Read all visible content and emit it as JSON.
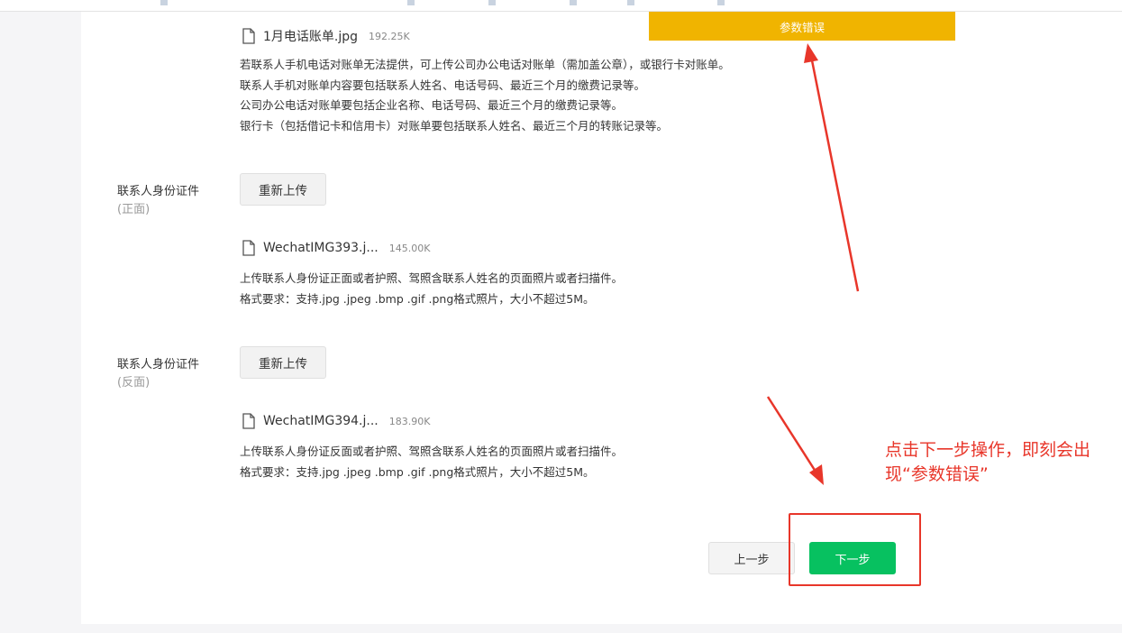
{
  "toast": {
    "text": "参数错误"
  },
  "bill_section": {
    "file": {
      "name": "1月电话账单.jpg",
      "size": "192.25K",
      "icon": "file-icon"
    },
    "description": [
      "若联系人手机电话对账单无法提供，可上传公司办公电话对账单（需加盖公章），或银行卡对账单。",
      "联系人手机对账单内容要包括联系人姓名、电话号码、最近三个月的缴费记录等。",
      "公司办公电话对账单要包括企业名称、电话号码、最近三个月的缴费记录等。",
      "银行卡（包括借记卡和信用卡）对账单要包括联系人姓名、最近三个月的转账记录等。"
    ]
  },
  "id_front": {
    "label": "联系人身份证件",
    "sublabel": "(正面)",
    "button": "重新上传",
    "file": {
      "name": "WechatIMG393.j...",
      "size": "145.00K",
      "icon": "file-icon"
    },
    "description": [
      "上传联系人身份证正面或者护照、驾照含联系人姓名的页面照片或者扫描件。",
      "格式要求：支持.jpg .jpeg .bmp .gif .png格式照片，大小不超过5M。"
    ]
  },
  "id_back": {
    "label": "联系人身份证件",
    "sublabel": "(反面)",
    "button": "重新上传",
    "file": {
      "name": "WechatIMG394.j...",
      "size": "183.90K",
      "icon": "file-icon"
    },
    "description": [
      "上传联系人身份证反面或者护照、驾照含联系人姓名的页面照片或者扫描件。",
      "格式要求：支持.jpg .jpeg .bmp .gif .png格式照片，大小不超过5M。"
    ]
  },
  "footer": {
    "prev_label": "上一步",
    "next_label": "下一步"
  },
  "annotation": {
    "lines": [
      "点击下一步操作，即刻会出",
      "现“参数错误”"
    ],
    "color": "#e8362a"
  },
  "colors": {
    "toast": "#f0b400",
    "primary": "#07c160",
    "annotation": "#e8362a"
  }
}
